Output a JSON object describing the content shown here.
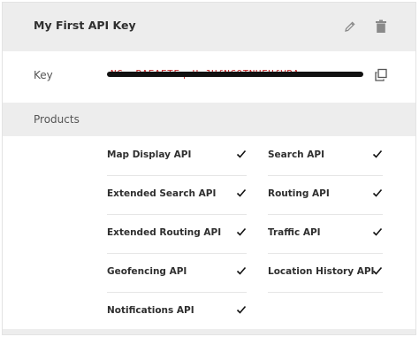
{
  "card": {
    "title": "My First API Key",
    "actions": {
      "edit_icon": "pencil-icon",
      "delete_icon": "trash-icon"
    }
  },
  "key": {
    "label": "Key",
    "value": "NGcvBAEAETFqaHcJUfNCOTNHFUfVRA",
    "copy_icon": "copy-icon"
  },
  "products": {
    "label": "Products",
    "items": [
      {
        "name": "Map Display API",
        "enabled": true
      },
      {
        "name": "Search API",
        "enabled": true
      },
      {
        "name": "Extended Search API",
        "enabled": true
      },
      {
        "name": "Routing API",
        "enabled": true
      },
      {
        "name": "Extended Routing API",
        "enabled": true
      },
      {
        "name": "Traffic API",
        "enabled": true
      },
      {
        "name": "Geofencing API",
        "enabled": true
      },
      {
        "name": "Location History API",
        "enabled": true
      },
      {
        "name": "Notifications API",
        "enabled": true
      }
    ]
  },
  "colors": {
    "header_bg": "#ededed",
    "text": "#2f2f2f",
    "icon": "#8a8a8a"
  }
}
